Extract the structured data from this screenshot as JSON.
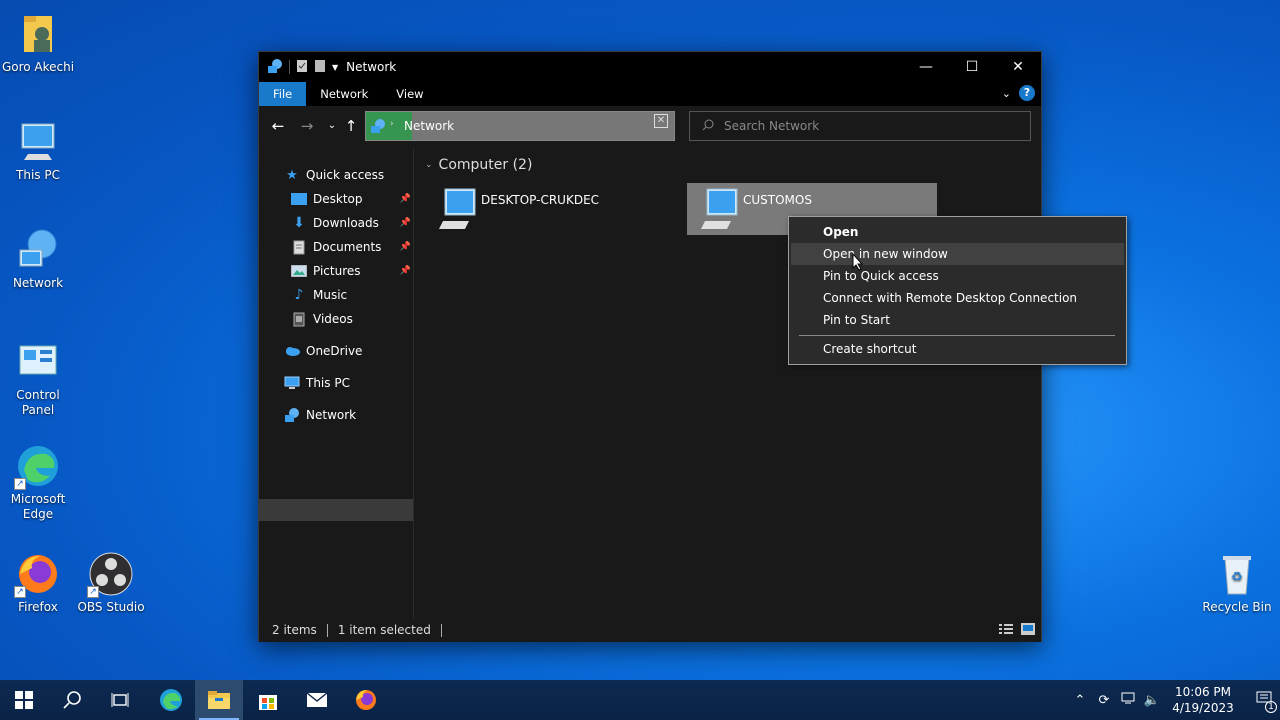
{
  "desktop": {
    "icons": [
      {
        "label": "Goro Akechi"
      },
      {
        "label": "This PC"
      },
      {
        "label": "Network"
      },
      {
        "label": "Control Panel"
      },
      {
        "label": "Microsoft Edge"
      },
      {
        "label": "Firefox"
      },
      {
        "label": "OBS Studio"
      },
      {
        "label": "Recycle Bin"
      }
    ]
  },
  "window": {
    "title": "Network",
    "ribbon_tabs": [
      "File",
      "Network",
      "View"
    ],
    "help_label": "?",
    "address": "Network",
    "search_placeholder": "Search Network"
  },
  "navpane": {
    "items": [
      {
        "label": "Quick access",
        "icon": "star-icon"
      },
      {
        "label": "Desktop",
        "icon": "desktop-icon",
        "pinned": true
      },
      {
        "label": "Downloads",
        "icon": "download-icon",
        "pinned": true
      },
      {
        "label": "Documents",
        "icon": "documents-icon",
        "pinned": true
      },
      {
        "label": "Pictures",
        "icon": "pictures-icon",
        "pinned": true
      },
      {
        "label": "Music",
        "icon": "music-icon"
      },
      {
        "label": "Videos",
        "icon": "videos-icon"
      },
      {
        "label": "OneDrive",
        "icon": "cloud-icon"
      },
      {
        "label": "This PC",
        "icon": "pc-icon"
      },
      {
        "label": "Network",
        "icon": "network-icon",
        "selected": true
      }
    ]
  },
  "content": {
    "group_header": "Computer (2)",
    "items": [
      {
        "name": "DESKTOP-CRUKDEC",
        "selected": false
      },
      {
        "name": "CUSTOMOS",
        "selected": true
      }
    ]
  },
  "statusbar": {
    "count": "2 items",
    "selection": "1 item selected"
  },
  "context_menu": {
    "items": [
      {
        "label": "Open",
        "bold": true
      },
      {
        "label": "Open in new window",
        "hover": true
      },
      {
        "label": "Pin to Quick access"
      },
      {
        "label": "Connect with Remote Desktop Connection"
      },
      {
        "label": "Pin to Start"
      },
      {
        "label": "Create shortcut"
      }
    ]
  },
  "taskbar": {
    "time": "10:06 PM",
    "date": "4/19/2023",
    "notification_count": "1"
  },
  "colors": {
    "accent": "#1979ca",
    "selection": "#7a7a7a",
    "window_bg": "#191919"
  }
}
